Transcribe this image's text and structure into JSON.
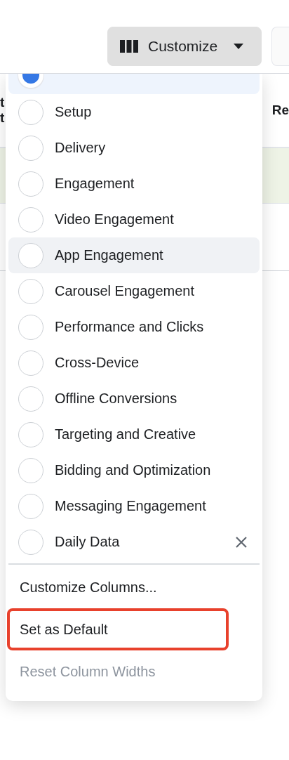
{
  "toolbar": {
    "customize_button": {
      "label": "Customize",
      "expanded": true
    }
  },
  "table": {
    "columns": [
      {
        "label": "t\nt"
      },
      {
        "label": "Re"
      }
    ]
  },
  "menu": {
    "presets": [
      {
        "selected": true,
        "hovered": false
      },
      {
        "label": "Setup",
        "selected": false,
        "hovered": false
      },
      {
        "label": "Delivery",
        "selected": false,
        "hovered": false
      },
      {
        "label": "Engagement",
        "selected": false,
        "hovered": false
      },
      {
        "label": "Video Engagement",
        "selected": false,
        "hovered": false
      },
      {
        "label": "App Engagement",
        "selected": false,
        "hovered": true
      },
      {
        "label": "Carousel Engagement",
        "selected": false,
        "hovered": false
      },
      {
        "label": "Performance and Clicks",
        "selected": false,
        "hovered": false
      },
      {
        "label": "Cross-Device",
        "selected": false,
        "hovered": false
      },
      {
        "label": "Offline Conversions",
        "selected": false,
        "hovered": false
      },
      {
        "label": "Targeting and Creative",
        "selected": false,
        "hovered": false
      },
      {
        "label": "Bidding and Optimization",
        "selected": false,
        "hovered": false
      },
      {
        "label": "Messaging Engagement",
        "selected": false,
        "hovered": false
      },
      {
        "label": "Daily Data",
        "selected": false,
        "hovered": false,
        "removable": true
      }
    ],
    "actions": [
      {
        "label": "Customize Columns...",
        "disabled": false,
        "highlighted": false
      },
      {
        "label": "Set as Default",
        "disabled": false,
        "highlighted": true
      },
      {
        "label": "Reset Column Widths",
        "disabled": true,
        "highlighted": false
      }
    ]
  }
}
